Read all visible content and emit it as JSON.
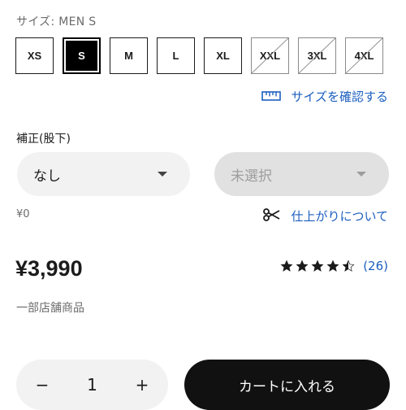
{
  "size": {
    "label_prefix": "サイズ: ",
    "label_value": "MEN S",
    "options": [
      {
        "label": "XS",
        "state": "available"
      },
      {
        "label": "S",
        "state": "selected"
      },
      {
        "label": "M",
        "state": "available"
      },
      {
        "label": "L",
        "state": "available"
      },
      {
        "label": "XL",
        "state": "available"
      },
      {
        "label": "XXL",
        "state": "sold-out"
      },
      {
        "label": "3XL",
        "state": "sold-out"
      },
      {
        "label": "4XL",
        "state": "sold-out"
      }
    ],
    "guide_label": "サイズを確認する",
    "guide_icon": "ruler-icon"
  },
  "alteration": {
    "label": "補正(股下)",
    "selected": "なし",
    "secondary_placeholder": "未選択",
    "price": "¥0",
    "finish_label": "仕上がりについて",
    "finish_icon": "scissors-icon"
  },
  "product": {
    "price": "¥3,990",
    "rating_value": 4.5,
    "review_count": "(26)",
    "availability_note": "一部店舗商品"
  },
  "purchase": {
    "minus": "−",
    "quantity": "1",
    "plus": "+",
    "cart_label": "カートに入れる"
  },
  "colors": {
    "link": "#1c5fbf",
    "primary_button": "#111111",
    "pill_bg": "#f2f2f2",
    "disabled_bg": "#e1e1e1"
  }
}
